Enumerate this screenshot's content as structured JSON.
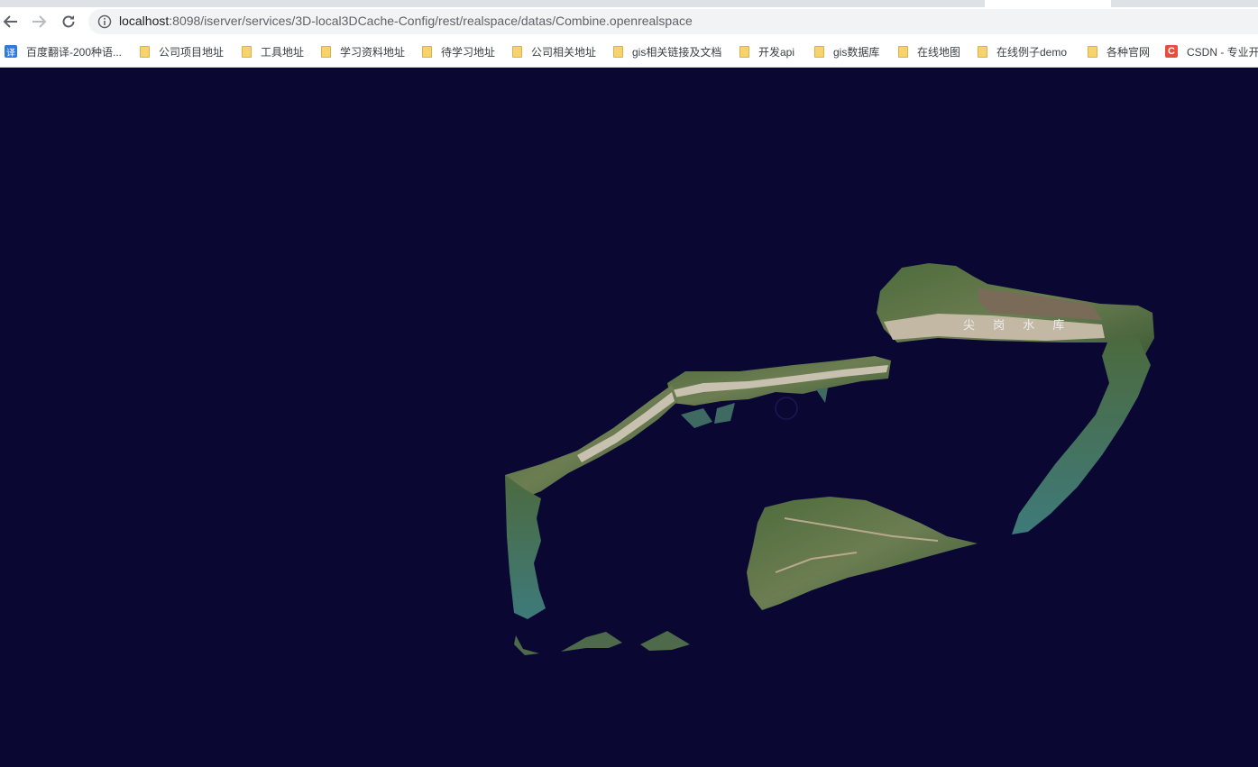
{
  "browser": {
    "url_host": "localhost",
    "url_rest": ":8098/iserver/services/3D-local3DCache-Config/rest/realspace/datas/Combine.openrealspace"
  },
  "bookmarks": [
    {
      "label": "百度翻译-200种语...",
      "icon": "baidu-translate-icon",
      "icon_text": "译"
    },
    {
      "label": "公司项目地址",
      "icon": "folder-icon"
    },
    {
      "label": "工具地址",
      "icon": "folder-icon"
    },
    {
      "label": "学习资料地址",
      "icon": "folder-icon"
    },
    {
      "label": "待学习地址",
      "icon": "folder-icon"
    },
    {
      "label": "公司相关地址",
      "icon": "folder-icon"
    },
    {
      "label": "gis相关链接及文档",
      "icon": "folder-icon"
    },
    {
      "label": "开发api",
      "icon": "folder-icon"
    },
    {
      "label": "gis数据库",
      "icon": "folder-icon"
    },
    {
      "label": "在线地图",
      "icon": "folder-icon"
    },
    {
      "label": "在线例子demo",
      "icon": "folder-icon"
    },
    {
      "label": "各种官网",
      "icon": "folder-icon"
    },
    {
      "label": "CSDN - 专业开",
      "icon": "csdn-icon",
      "icon_text": "C"
    }
  ],
  "scene": {
    "background": "#0a0833",
    "map_label": "尖 岗 水 库"
  },
  "colors": {
    "terrain_green": "#3f5a35",
    "terrain_light": "#7a8a5a",
    "road": "#bfb8a8",
    "water_edge": "#3a6d6e"
  }
}
